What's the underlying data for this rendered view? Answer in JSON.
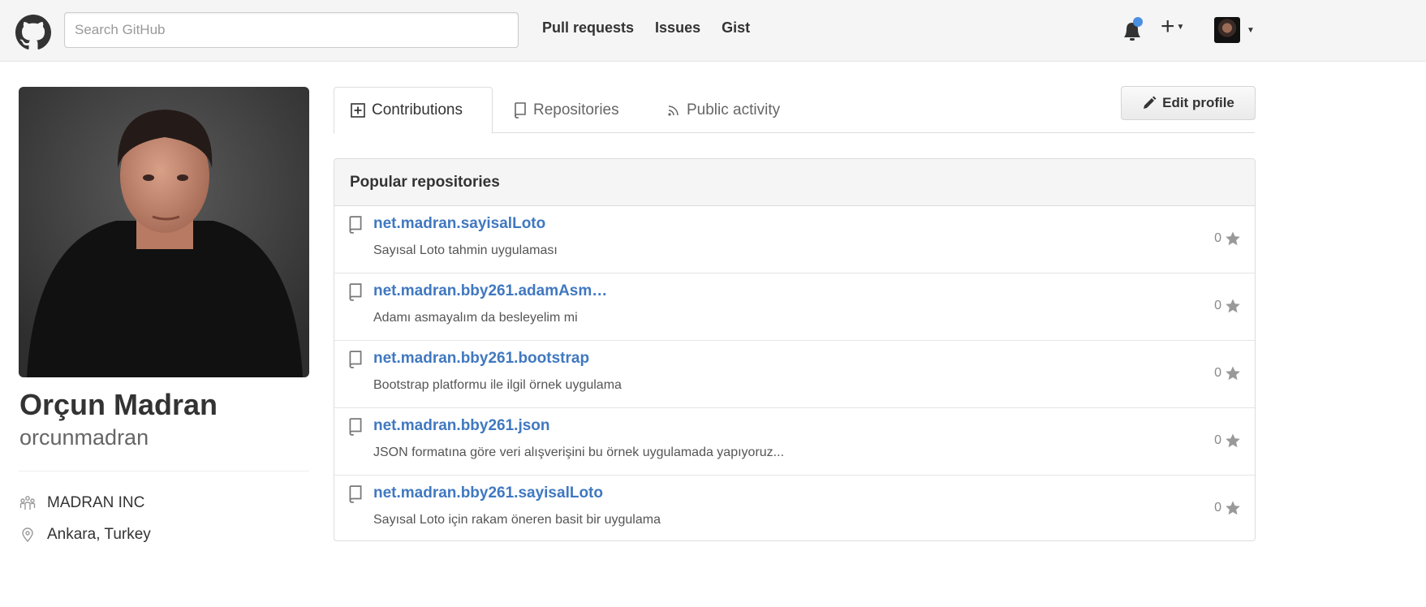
{
  "header": {
    "search_placeholder": "Search GitHub",
    "nav": [
      "Pull requests",
      "Issues",
      "Gist"
    ],
    "plus_label": "+",
    "notification_color": "#4a90e2"
  },
  "profile": {
    "fullname": "Orçun Madran",
    "username": "orcunmadran",
    "organization": "MADRAN INC",
    "location": "Ankara, Turkey"
  },
  "tabs": [
    {
      "label": "Contributions",
      "icon": "plus-square-icon",
      "active": true
    },
    {
      "label": "Repositories",
      "icon": "repo-icon",
      "active": false
    },
    {
      "label": "Public activity",
      "icon": "rss-icon",
      "active": false
    }
  ],
  "edit_profile_label": "Edit profile",
  "repos": {
    "title": "Popular repositories",
    "items": [
      {
        "name": "net.madran.sayisalLoto",
        "description": "Sayısal Loto tahmin uygulaması",
        "stars": "0"
      },
      {
        "name": "net.madran.bby261.adamAsm…",
        "description": "Adamı asmayalım da besleyelim mi",
        "stars": "0"
      },
      {
        "name": "net.madran.bby261.bootstrap",
        "description": "Bootstrap platformu ile ilgil örnek uygulama",
        "stars": "0"
      },
      {
        "name": "net.madran.bby261.json",
        "description": "JSON formatına göre veri alışverişini bu örnek uygulamada yapıyoruz...",
        "stars": "0"
      },
      {
        "name": "net.madran.bby261.sayisalLoto",
        "description": "Sayısal Loto için rakam öneren basit bir uygulama",
        "stars": "0"
      }
    ]
  },
  "colors": {
    "link": "#4078c0",
    "header_bg": "#f5f5f5"
  }
}
